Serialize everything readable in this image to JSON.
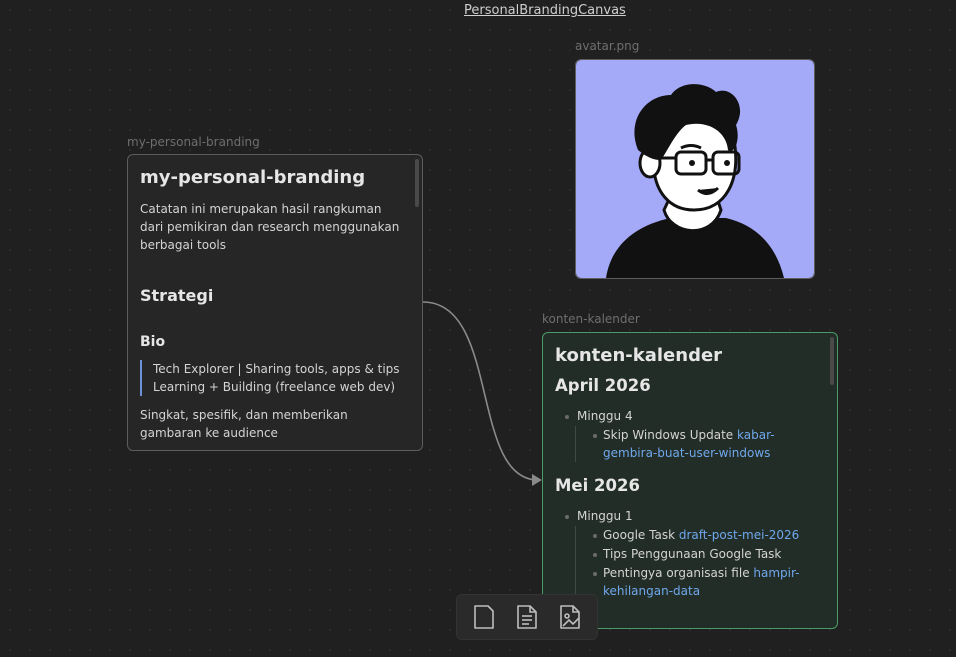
{
  "canvas": {
    "title": "PersonalBrandingCanvas"
  },
  "nodes": {
    "branding": {
      "label": "my-personal-branding",
      "heading": "my-personal-branding",
      "intro": "Catatan ini merupakan hasil rangkuman dari pemikiran dan research menggunakan berbagai tools",
      "section_strategi": "Strategi",
      "section_bio": "Bio",
      "quote_lines": [
        "Tech Explorer | Sharing tools, apps & tips",
        "Learning + Building (freelance web dev)"
      ],
      "summary": "Singkat, spesifik, dan memberikan gambaran ke audience"
    },
    "avatar": {
      "label": "avatar.png",
      "bg_color": "#a5aaf8"
    },
    "kalender": {
      "label": "konten-kalender",
      "heading": "konten-kalender",
      "month1": "April 2026",
      "week1": "Minggu 4",
      "item1_text": "Skip Windows Update ",
      "item1_link": "kabar-gembira-buat-user-windows",
      "month2": "Mei 2026",
      "week2": "Minggu 1",
      "item2_text": "Google Task ",
      "item2_link": "draft-post-mei-2026",
      "item3_text": "Tips Penggunaan Google Task",
      "item4_text": "Pentingya organisasi file ",
      "item4_link": "hampir-kehilangan-data"
    }
  },
  "toolbar": {
    "items": [
      {
        "icon": "blank-card-icon"
      },
      {
        "icon": "note-card-icon"
      },
      {
        "icon": "media-card-icon"
      }
    ]
  },
  "colors": {
    "accent_green": "#4a9b67",
    "link_blue": "#6fa8ec",
    "quote_blue": "#6d8fd8"
  }
}
